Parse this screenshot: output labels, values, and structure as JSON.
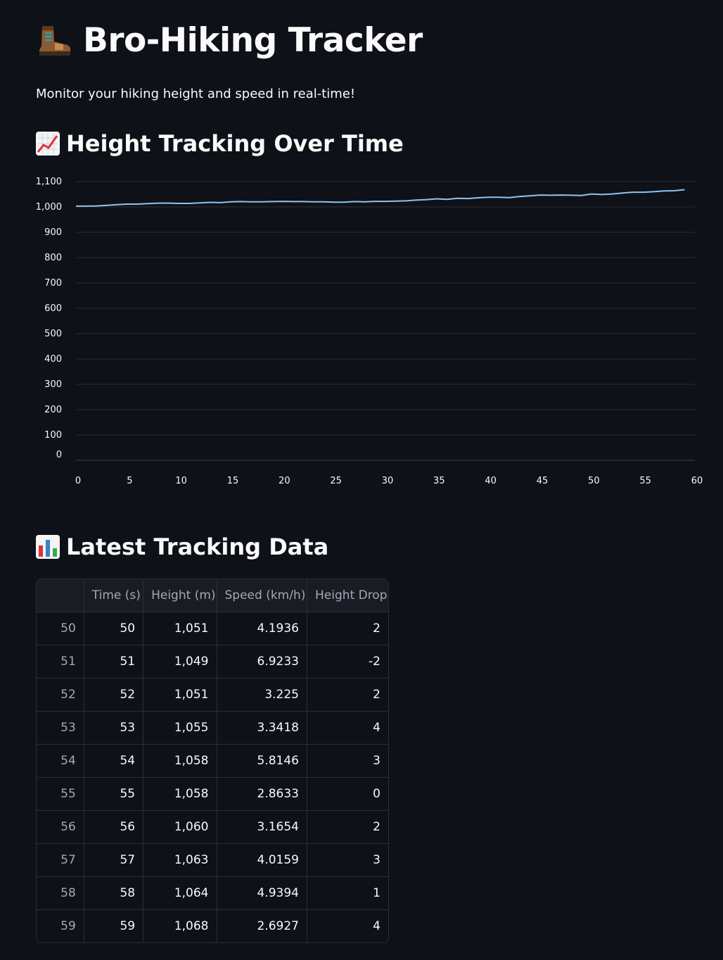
{
  "page": {
    "title": "Bro-Hiking Tracker",
    "title_icon": "hiking-boot-icon",
    "subtitle": "Monitor your hiking height and speed in real-time!"
  },
  "chart_section": {
    "title": "Height Tracking Over Time",
    "icon": "chart-increasing-icon"
  },
  "table_section": {
    "title": "Latest Tracking Data",
    "icon": "bar-chart-icon"
  },
  "chart_data": {
    "type": "line",
    "title": "",
    "xlabel": "",
    "ylabel": "",
    "xlim": [
      0,
      60
    ],
    "ylim": [
      0,
      1100
    ],
    "xticks": [
      "0",
      "5",
      "10",
      "15",
      "20",
      "25",
      "30",
      "35",
      "40",
      "45",
      "50",
      "55",
      "60"
    ],
    "yticks": [
      "0",
      "100",
      "200",
      "300",
      "400",
      "500",
      "600",
      "700",
      "800",
      "900",
      "1,000",
      "1,100"
    ],
    "grid": true,
    "line_color": "#8ec3f0",
    "series": [
      {
        "x": [
          0,
          1,
          2,
          3,
          4,
          5,
          6,
          7,
          8,
          9,
          10,
          11,
          12,
          13,
          14,
          15,
          16,
          17,
          18,
          19,
          20,
          21,
          22,
          23,
          24,
          25,
          26,
          27,
          28,
          29,
          30,
          31,
          32,
          33,
          34,
          35,
          36,
          37,
          38,
          39,
          40,
          41,
          42,
          43,
          44,
          45,
          46,
          47,
          48,
          49,
          50,
          51,
          52,
          53,
          54,
          55,
          56,
          57,
          58,
          59
        ],
        "y": [
          1003,
          1003,
          1004,
          1006,
          1009,
          1011,
          1011,
          1013,
          1015,
          1015,
          1014,
          1014,
          1016,
          1018,
          1017,
          1020,
          1021,
          1020,
          1020,
          1021,
          1022,
          1021,
          1021,
          1020,
          1020,
          1019,
          1019,
          1021,
          1020,
          1022,
          1022,
          1023,
          1024,
          1027,
          1029,
          1032,
          1030,
          1034,
          1033,
          1036,
          1038,
          1038,
          1037,
          1041,
          1044,
          1047,
          1046,
          1047,
          1046,
          1045,
          1051,
          1049,
          1051,
          1055,
          1058,
          1058,
          1060,
          1063,
          1064,
          1068
        ]
      }
    ]
  },
  "table": {
    "columns": [
      "",
      "Time (s)",
      "Height (m)",
      "Speed (km/h)",
      "Height Drop"
    ],
    "rows": [
      [
        "50",
        "50",
        "1,051",
        "4.1936",
        "2"
      ],
      [
        "51",
        "51",
        "1,049",
        "6.9233",
        "-2"
      ],
      [
        "52",
        "52",
        "1,051",
        "3.225",
        "2"
      ],
      [
        "53",
        "53",
        "1,055",
        "3.3418",
        "4"
      ],
      [
        "54",
        "54",
        "1,058",
        "5.8146",
        "3"
      ],
      [
        "55",
        "55",
        "1,058",
        "2.8633",
        "0"
      ],
      [
        "56",
        "56",
        "1,060",
        "3.1654",
        "2"
      ],
      [
        "57",
        "57",
        "1,063",
        "4.0159",
        "3"
      ],
      [
        "58",
        "58",
        "1,064",
        "4.9394",
        "1"
      ],
      [
        "59",
        "59",
        "1,068",
        "2.6927",
        "4"
      ]
    ]
  }
}
